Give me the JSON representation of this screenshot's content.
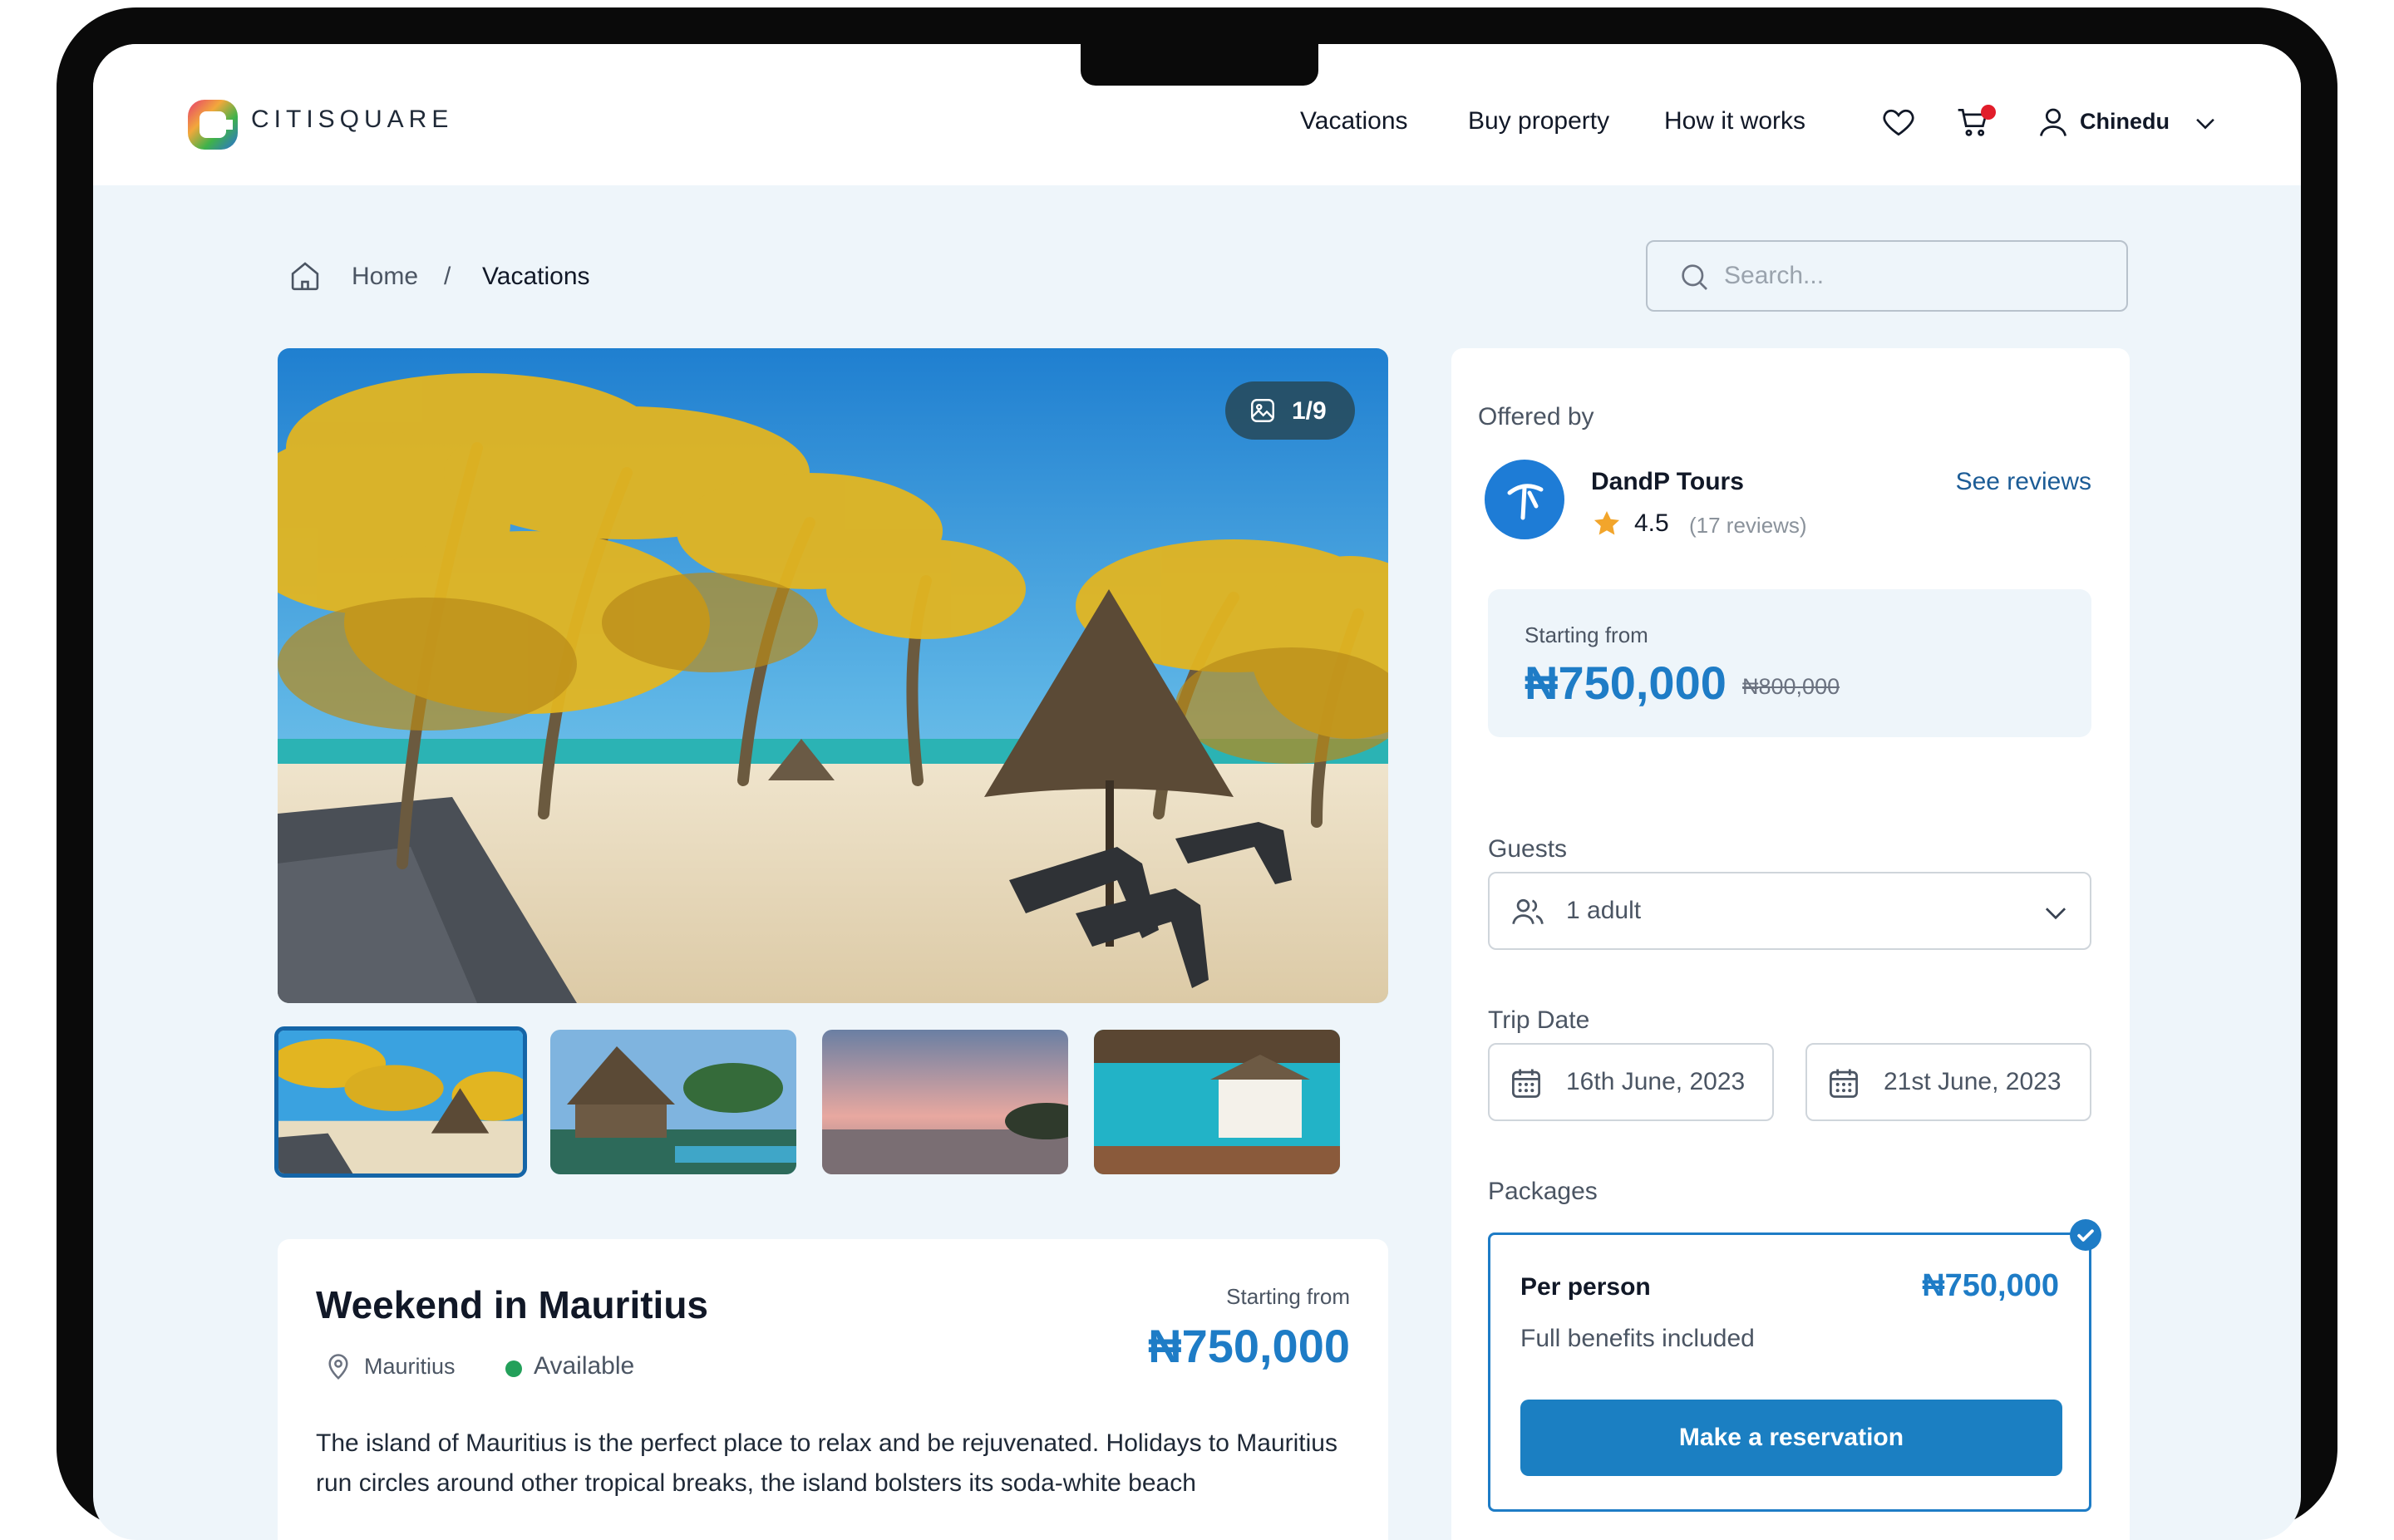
{
  "brand": {
    "name": "CITISQUARE"
  },
  "nav": {
    "links": [
      "Vacations",
      "Buy property",
      "How it works"
    ],
    "user": "Chinedu",
    "cart_has_notification": true
  },
  "breadcrumb": {
    "home": "Home",
    "separator": "/",
    "current": "Vacations"
  },
  "search": {
    "placeholder": "Search..."
  },
  "gallery": {
    "counter": "1/9",
    "thumbnail_count": 4,
    "active_index": 0
  },
  "listing": {
    "title": "Weekend in Mauritius",
    "location": "Mauritius",
    "status": "Available",
    "price_label": "Starting from",
    "price": "₦750,000",
    "description": "The island of Mauritius is the perfect place to relax and be rejuvenated. Holidays to Mauritius run circles around other tropical breaks, the island bolsters its soda-white beach"
  },
  "sidebar": {
    "offered_by_label": "Offered by",
    "vendor": {
      "name": "DandP Tours",
      "rating": "4.5",
      "reviews": "(17 reviews)",
      "see_reviews": "See reviews"
    },
    "price_box": {
      "label": "Starting from",
      "price": "₦750,000",
      "old_price": "₦800,000"
    },
    "guests": {
      "label": "Guests",
      "value": "1 adult"
    },
    "trip_date": {
      "label": "Trip Date",
      "start": "16th June, 2023",
      "end": "21st June, 2023"
    },
    "packages": {
      "label": "Packages",
      "items": [
        {
          "name": "Per person",
          "price": "₦750,000",
          "description": "Full benefits included",
          "selected": true
        }
      ]
    },
    "cta": "Make a reservation"
  },
  "colors": {
    "accent": "#1e7cc6",
    "button": "#1b7fc2",
    "background": "#eef5fa",
    "status_available": "#23a05a",
    "notification": "#e11d2a"
  }
}
